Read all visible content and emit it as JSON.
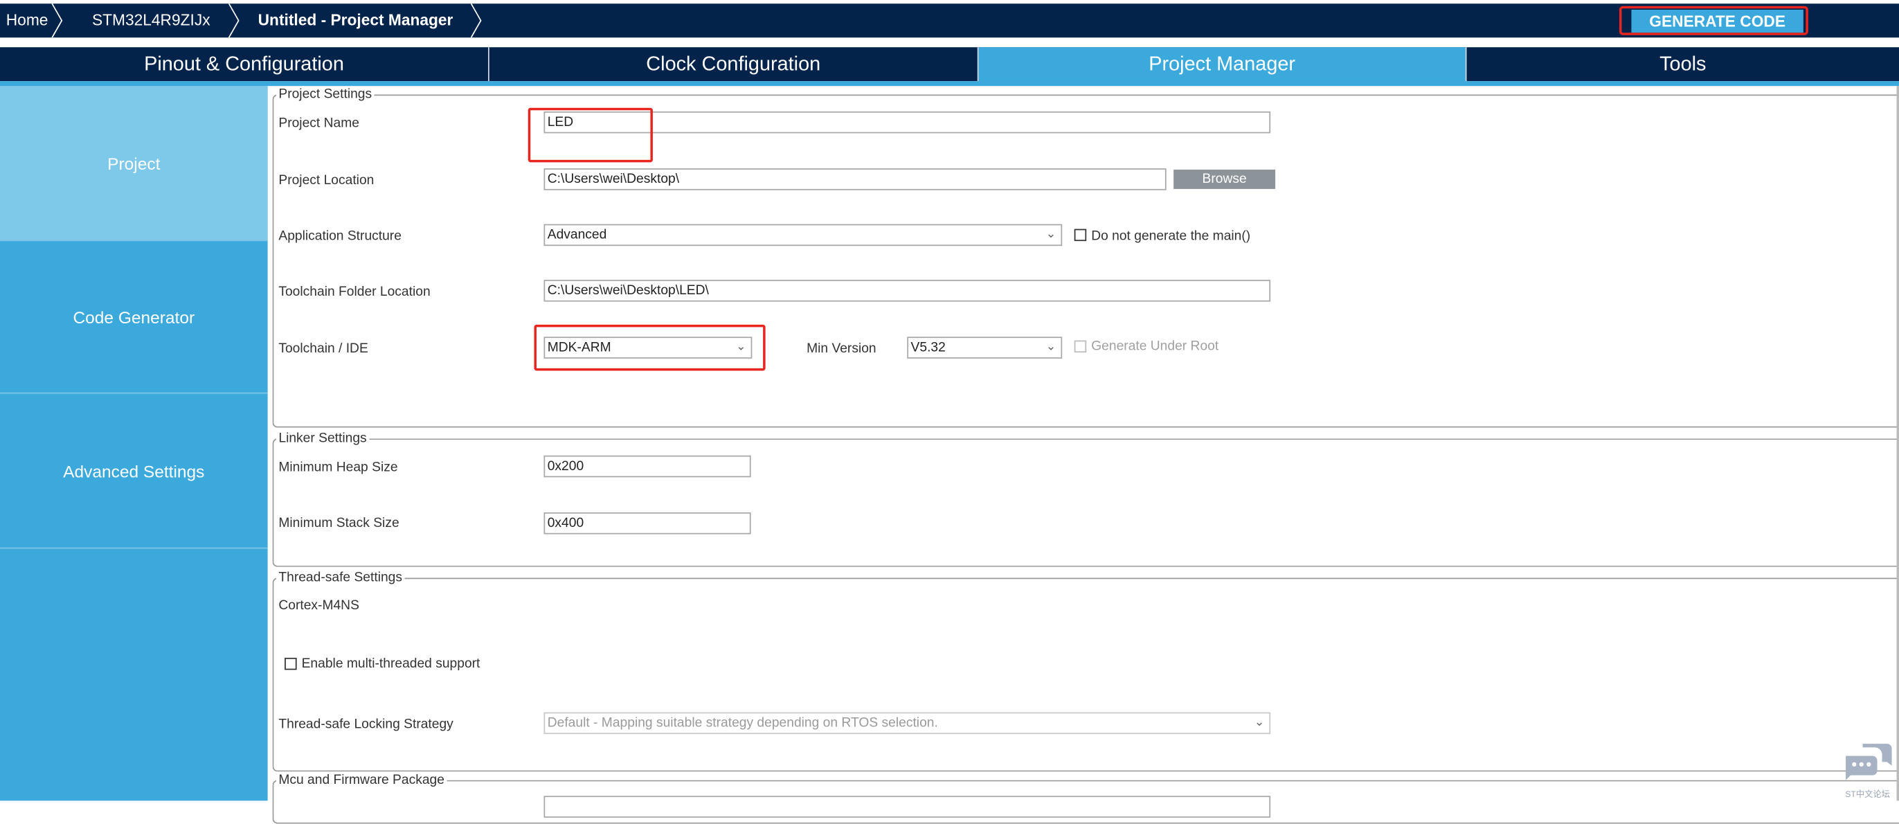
{
  "breadcrumb": [
    "Home",
    "STM32L4R9ZIJx",
    "Untitled - Project Manager"
  ],
  "generate_code": "GENERATE CODE",
  "tabs": [
    "Pinout & Configuration",
    "Clock Configuration",
    "Project Manager",
    "Tools"
  ],
  "active_tab": "Project Manager",
  "sidebar": [
    "Project",
    "Code Generator",
    "Advanced Settings"
  ],
  "project_settings": {
    "legend": "Project Settings",
    "project_name_label": "Project Name",
    "project_name": "LED",
    "project_location_label": "Project Location",
    "project_location": "C:\\Users\\wei\\Desktop\\",
    "browse": "Browse",
    "app_structure_label": "Application Structure",
    "app_structure": "Advanced",
    "no_main_label": "Do not generate the main()",
    "toolchain_folder_label": "Toolchain Folder Location",
    "toolchain_folder": "C:\\Users\\wei\\Desktop\\LED\\",
    "toolchain_label": "Toolchain / IDE",
    "toolchain": "MDK-ARM",
    "min_version_label": "Min Version",
    "min_version": "V5.32",
    "gen_under_root_label": "Generate Under Root"
  },
  "linker_settings": {
    "legend": "Linker Settings",
    "heap_label": "Minimum Heap Size",
    "heap": "0x200",
    "stack_label": "Minimum Stack Size",
    "stack": "0x400"
  },
  "thread_safe": {
    "legend": "Thread-safe Settings",
    "core": "Cortex-M4NS",
    "multithread_label": "Enable multi-threaded support",
    "locking_label": "Thread-safe Locking Strategy",
    "locking": "Default  -  Mapping suitable strategy depending on RTOS selection."
  },
  "mcu_firmware": {
    "legend": "Mcu and Firmware Package"
  },
  "watermark": "ST中文论坛",
  "colors": {
    "navy": "#03234b",
    "accent": "#3ba9dc",
    "highlight": "#e8251f"
  }
}
